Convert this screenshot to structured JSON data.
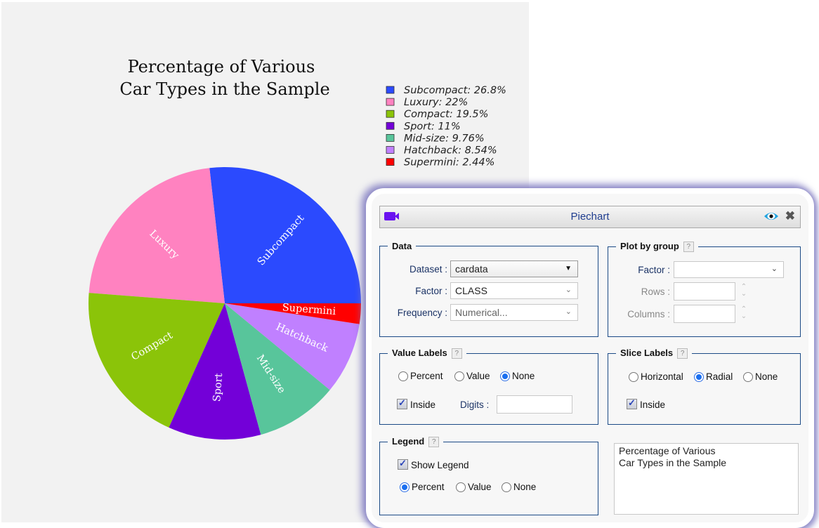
{
  "chart_data": {
    "type": "pie",
    "title": "Percentage of Various\nCar Types in the Sample",
    "title_lines": [
      "Percentage of Various",
      "Car Types in the Sample"
    ],
    "start_angle_deg": 0,
    "direction": "counterclockwise",
    "slice_label_style": "radial-inside",
    "legend_position": "top-right",
    "slices": [
      {
        "label": "Subcompact",
        "percent": 26.8,
        "legend": "Subcompact: 26.8%",
        "color": "#2b4afe"
      },
      {
        "label": "Luxury",
        "percent": 22,
        "legend": "Luxury: 22%",
        "color": "#ff82c0"
      },
      {
        "label": "Compact",
        "percent": 19.5,
        "legend": "Compact: 19.5%",
        "color": "#8bc409"
      },
      {
        "label": "Sport",
        "percent": 11,
        "legend": "Sport: 11%",
        "color": "#7300d8"
      },
      {
        "label": "Mid-size",
        "percent": 9.76,
        "legend": "Mid-size: 9.76%",
        "color": "#58c59b"
      },
      {
        "label": "Hatchback",
        "percent": 8.54,
        "legend": "Hatchback: 8.54%",
        "color": "#c080ff"
      },
      {
        "label": "Supermini",
        "percent": 2.44,
        "legend": "Supermini: 2.44%",
        "color": "#ff0000"
      }
    ]
  },
  "dialog": {
    "title": "Piechart",
    "icons": {
      "left": "video-camera-icon",
      "preview": "eye-icon",
      "close": "close-icon"
    },
    "data_section": {
      "legend": "Data",
      "dataset_label": "Dataset :",
      "dataset_value": "cardata",
      "factor_label": "Factor :",
      "factor_value": "CLASS",
      "frequency_label": "Frequency :",
      "frequency_value": "Numerical..."
    },
    "plot_by_group": {
      "legend": "Plot by group",
      "help": "?",
      "factor_label": "Factor :",
      "factor_value": "",
      "rows_label": "Rows :",
      "rows_value": "",
      "columns_label": "Columns :",
      "columns_value": ""
    },
    "value_labels": {
      "legend": "Value Labels",
      "help": "?",
      "options": [
        "Percent",
        "Value",
        "None"
      ],
      "selected": "None",
      "inside_label": "Inside",
      "inside_checked": true,
      "digits_label": "Digits :",
      "digits_value": ""
    },
    "slice_labels": {
      "legend": "Slice Labels",
      "help": "?",
      "options": [
        "Horizontal",
        "Radial",
        "None"
      ],
      "selected": "Radial",
      "inside_label": "Inside",
      "inside_checked": true
    },
    "legend_section": {
      "legend": "Legend",
      "help": "?",
      "show_legend_label": "Show Legend",
      "show_legend_checked": true,
      "options": [
        "Percent",
        "Value",
        "None"
      ],
      "selected": "Percent"
    },
    "title_text": "Percentage of Various\nCar Types in the Sample"
  }
}
